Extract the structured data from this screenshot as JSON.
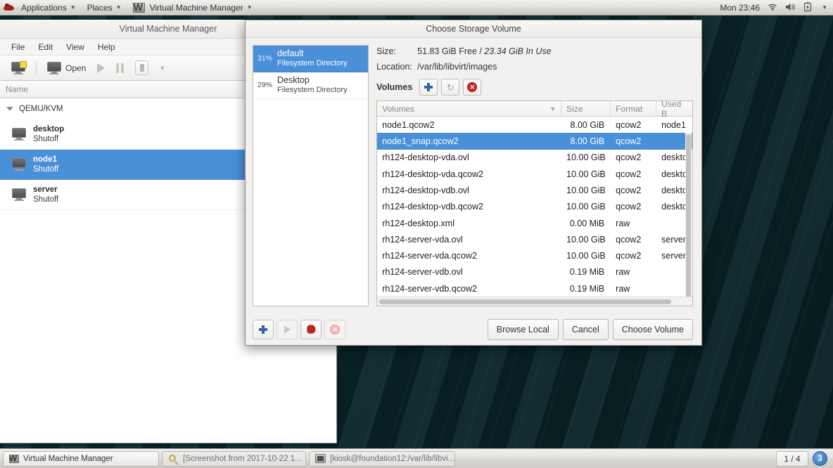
{
  "top_panel": {
    "applications_label": "Applications",
    "places_label": "Places",
    "active_app_label": "Virtual Machine Manager",
    "clock": "Mon 23:46",
    "caret": "▼"
  },
  "vmm_window": {
    "title": "Virtual Machine Manager",
    "menus": [
      "File",
      "Edit",
      "View",
      "Help"
    ],
    "toolbar": {
      "open_label": "Open",
      "caret": "▼"
    },
    "column_header": "Name",
    "sort_caret": "▼",
    "group_label": "QEMU/KVM",
    "group_caret": "▼",
    "vms": [
      {
        "name": "desktop",
        "state": "Shutoff",
        "selected": false
      },
      {
        "name": "node1",
        "state": "Shutoff",
        "selected": true
      },
      {
        "name": "server",
        "state": "Shutoff",
        "selected": false
      }
    ]
  },
  "dialog": {
    "title": "Choose Storage Volume",
    "pools": [
      {
        "percent": "31%",
        "name": "default",
        "type": "Filesystem Directory",
        "selected": true
      },
      {
        "percent": "29%",
        "name": "Desktop",
        "type": "Filesystem Directory",
        "selected": false
      }
    ],
    "size_label": "Size:",
    "size_free": "51.83 GiB Free /",
    "size_inuse": "23.34 GiB In Use",
    "location_label": "Location:",
    "location_value": "/var/lib/libvirt/images",
    "volumes_label": "Volumes",
    "table": {
      "columns": [
        "Volumes",
        "Size",
        "Format",
        "Used B"
      ],
      "sort_caret": "▼",
      "rows": [
        {
          "name": "node1.qcow2",
          "size": "8.00 GiB",
          "format": "qcow2",
          "used_by": "node1",
          "selected": false
        },
        {
          "name": "node1_snap.qcow2",
          "size": "8.00 GiB",
          "format": "qcow2",
          "used_by": "",
          "selected": true
        },
        {
          "name": "rh124-desktop-vda.ovl",
          "size": "10.00 GiB",
          "format": "qcow2",
          "used_by": "deskto",
          "selected": false
        },
        {
          "name": "rh124-desktop-vda.qcow2",
          "size": "10.00 GiB",
          "format": "qcow2",
          "used_by": "deskto",
          "selected": false
        },
        {
          "name": "rh124-desktop-vdb.ovl",
          "size": "10.00 GiB",
          "format": "qcow2",
          "used_by": "deskto",
          "selected": false
        },
        {
          "name": "rh124-desktop-vdb.qcow2",
          "size": "10.00 GiB",
          "format": "qcow2",
          "used_by": "deskto",
          "selected": false
        },
        {
          "name": "rh124-desktop.xml",
          "size": "0.00 MiB",
          "format": "raw",
          "used_by": "",
          "selected": false
        },
        {
          "name": "rh124-server-vda.ovl",
          "size": "10.00 GiB",
          "format": "qcow2",
          "used_by": "server",
          "selected": false
        },
        {
          "name": "rh124-server-vda.qcow2",
          "size": "10.00 GiB",
          "format": "qcow2",
          "used_by": "server",
          "selected": false
        },
        {
          "name": "rh124-server-vdb.ovl",
          "size": "0.19 MiB",
          "format": "raw",
          "used_by": "",
          "selected": false
        },
        {
          "name": "rh124-server-vdb.qcow2",
          "size": "0.19 MiB",
          "format": "raw",
          "used_by": "",
          "selected": false
        }
      ]
    },
    "buttons": {
      "browse_local": "Browse Local",
      "cancel": "Cancel",
      "choose_volume": "Choose Volume"
    }
  },
  "taskbar": {
    "items": [
      {
        "label": "Virtual Machine Manager"
      },
      {
        "label": "[Screenshot from 2017-10-22 1..."
      },
      {
        "label": "[kiosk@foundation12:/var/lib/libvi..."
      }
    ],
    "pager": "1 / 4",
    "notification_count": "3"
  },
  "colors": {
    "accent_blue": "#4a90d9",
    "desktop_teal": "#0c2e33",
    "panel_gray": "#e3e1de",
    "delete_red": "#cc2222"
  }
}
